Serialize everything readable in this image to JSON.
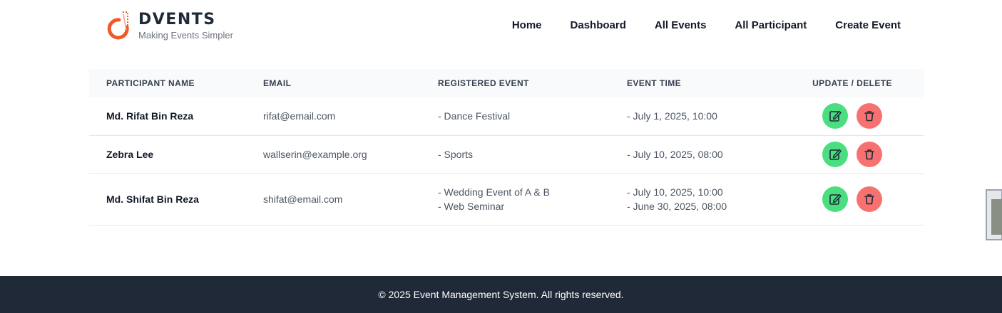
{
  "brand": {
    "name": "DVENTS",
    "tagline": "Making Events Simpler",
    "accent": "#f05a28"
  },
  "nav": [
    {
      "label": "Home"
    },
    {
      "label": "Dashboard"
    },
    {
      "label": "All Events"
    },
    {
      "label": "All Participant"
    },
    {
      "label": "Create Event"
    }
  ],
  "table": {
    "headers": [
      "PARTICIPANT NAME",
      "EMAIL",
      "REGISTERED EVENT",
      "EVENT TIME",
      "UPDATE / DELETE"
    ],
    "rows": [
      {
        "name": "Md. Rifat Bin Reza",
        "email": "rifat@email.com",
        "events": [
          "- Dance Festival"
        ],
        "times": [
          "- July 1, 2025, 10:00"
        ]
      },
      {
        "name": "Zebra Lee",
        "email": "wallserin@example.org",
        "events": [
          "- Sports"
        ],
        "times": [
          "- July 10, 2025, 08:00"
        ]
      },
      {
        "name": "Md. Shifat Bin Reza",
        "email": "shifat@email.com",
        "events": [
          "- Wedding Event of A & B",
          "- Web Seminar"
        ],
        "times": [
          "- July 10, 2025, 10:00",
          "- June 30, 2025, 08:00"
        ]
      }
    ],
    "edit_icon": "edit-icon",
    "delete_icon": "trash-icon",
    "edit_color": "#4ade80",
    "delete_color": "#f87171"
  },
  "footer": {
    "text": "© 2025 Event Management System. All rights reserved.",
    "bg": "#1f2937"
  }
}
